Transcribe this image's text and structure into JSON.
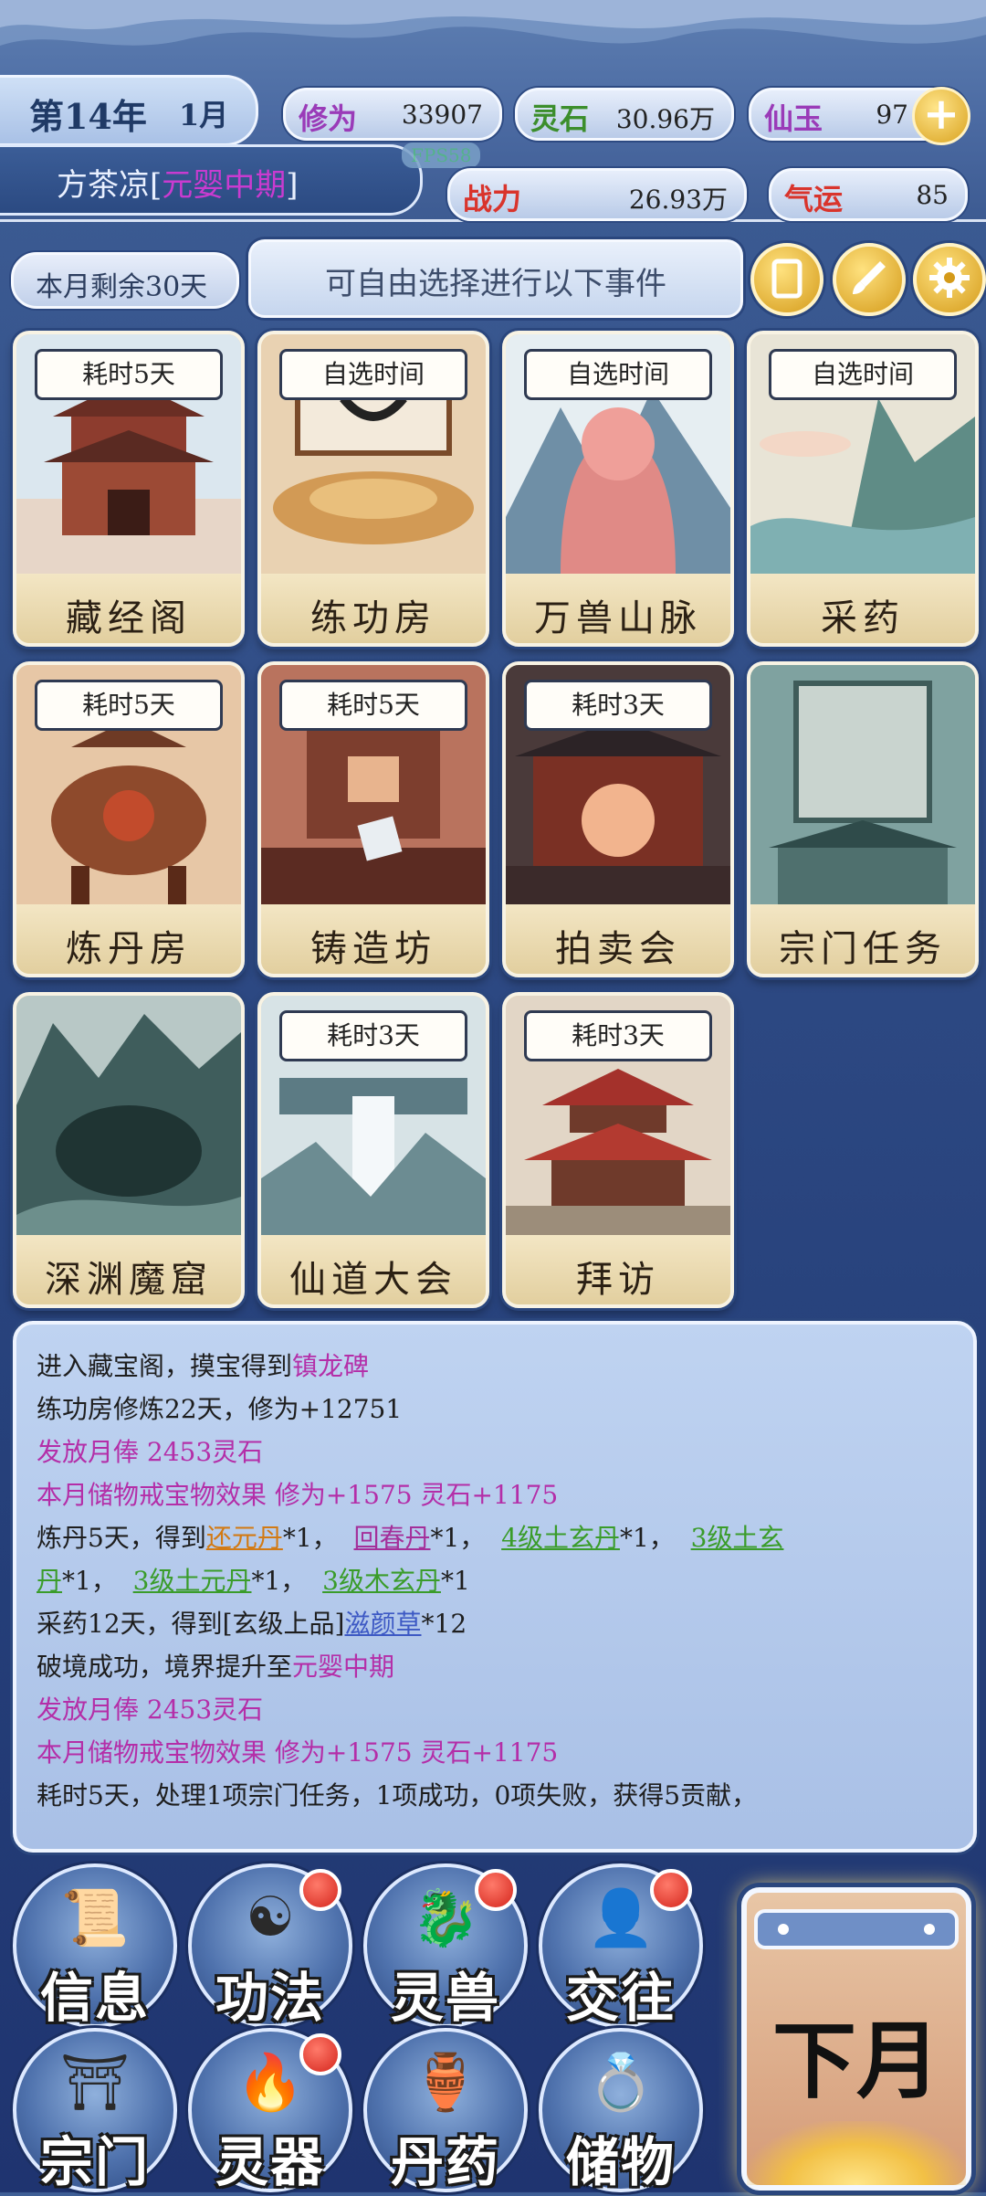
{
  "header": {
    "year": "第14年",
    "month": "1月",
    "player_name": "方茶凉",
    "realm": "元婴中期",
    "fps": "FPS58",
    "stats": {
      "cultivation_label": "修为",
      "cultivation_value": "33907",
      "spirit_stone_label": "灵石",
      "spirit_stone_value": "30.96万",
      "jade_label": "仙玉",
      "jade_value": "97",
      "power_label": "战力",
      "power_value": "26.93万",
      "luck_label": "气运",
      "luck_value": "85"
    }
  },
  "subbar": {
    "remaining": "本月剩余30天",
    "notice": "可自由选择进行以下事件",
    "icons": [
      "scroll-icon",
      "brush-icon",
      "gear-icon"
    ]
  },
  "events": [
    {
      "name": "藏经阁",
      "tag": "耗时5天"
    },
    {
      "name": "练功房",
      "tag": "自选时间"
    },
    {
      "name": "万兽山脉",
      "tag": "自选时间"
    },
    {
      "name": "采药",
      "tag": "自选时间"
    },
    {
      "name": "炼丹房",
      "tag": "耗时5天"
    },
    {
      "name": "铸造坊",
      "tag": "耗时5天"
    },
    {
      "name": "拍卖会",
      "tag": "耗时3天"
    },
    {
      "name": "宗门任务",
      "tag": ""
    },
    {
      "name": "深渊魔窟",
      "tag": ""
    },
    {
      "name": "仙道大会",
      "tag": "耗时3天"
    },
    {
      "name": "拜访",
      "tag": "耗时3天"
    }
  ],
  "log": {
    "l1_a": "进入藏宝阁，摸宝得到",
    "l1_b": "镇龙碑",
    "l2": "练功房修炼22天，修为+12751",
    "l3": "发放月俸 2453灵石",
    "l4": "本月储物戒宝物效果 修为+1575 灵石+1175",
    "l5_a": "炼丹5天，得到",
    "l5_b": "还元丹",
    "l5_c": "*1，",
    "l5_d": "回春丹",
    "l5_e": "*1，",
    "l5_f": "4级土玄丹",
    "l5_g": "*1，",
    "l5_h": "3级土玄",
    "l6_a": "丹",
    "l6_b": "*1，",
    "l6_c": "3级土元丹",
    "l6_d": "*1，",
    "l6_e": "3级木玄丹",
    "l6_f": "*1",
    "l7_a": "采药12天，得到[玄级上品]",
    "l7_b": "滋颜草",
    "l7_c": "*12",
    "l8_a": "破境成功，境界提升至",
    "l8_b": "元婴中期",
    "l9": "发放月俸 2453灵石",
    "l10": "本月储物戒宝物效果 修为+1575 灵石+1175",
    "l11": "耗时5天，处理1项宗门任务，1项成功，0项失败，获得5贡献，"
  },
  "nav": [
    {
      "label": "信息",
      "icon": "scroll-icon",
      "badge": false
    },
    {
      "label": "功法",
      "icon": "yin-yang-icon",
      "badge": true
    },
    {
      "label": "灵兽",
      "icon": "beast-icon",
      "badge": true
    },
    {
      "label": "交往",
      "icon": "person-icon",
      "badge": true
    },
    {
      "label": "宗门",
      "icon": "gate-icon",
      "badge": false
    },
    {
      "label": "灵器",
      "icon": "flame-orb-icon",
      "badge": true
    },
    {
      "label": "丹药",
      "icon": "gourd-icon",
      "badge": false
    },
    {
      "label": "储物",
      "icon": "ring-icon",
      "badge": false
    }
  ],
  "next_month": "下月",
  "colors": {
    "accent_gold": "#d9a21f",
    "realm_purple": "#c93bd0",
    "badge_red": "#d4251c"
  }
}
